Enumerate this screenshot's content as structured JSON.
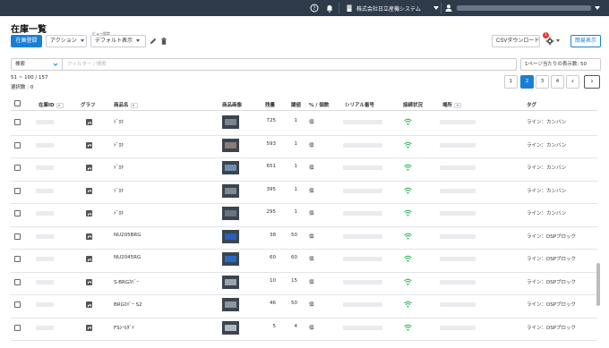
{
  "topbar": {
    "company": "株式会社日立産機システム",
    "icons": [
      "help-icon",
      "bell-icon",
      "building-icon",
      "user-icon"
    ]
  },
  "header": {
    "title": "在庫一覧",
    "register_label": "在庫登録",
    "action_label": "アクション",
    "view_setting_label": "ビュー設定",
    "view_value": "デフォルト表示",
    "csv_label": "CSVダウンロード",
    "settings_badge": "1",
    "simple_view_label": "簡易表示"
  },
  "search": {
    "field_label": "検索",
    "placeholder": "フィルター / 検索",
    "per_page_label": "1ページ当たりの表示数: 50"
  },
  "summary": {
    "range": "51 ~ 100 / 157",
    "selected": "選択数 : 0"
  },
  "pagination": {
    "pages": [
      "1",
      "2",
      "3",
      "4"
    ],
    "current": "2",
    "prev": "‹",
    "next": "›"
  },
  "table": {
    "columns": {
      "id": "在庫ID",
      "graph": "グラフ",
      "name": "商品名",
      "image": "商品画像",
      "qty": "残量",
      "threshold": "閾値",
      "unit": "% / 個数",
      "serial": "シリアル番号",
      "status": "接続状況",
      "place": "場所",
      "tag": "タグ"
    },
    "rows": [
      {
        "name": "ﾄﾞﾛｷ",
        "qty": "725",
        "threshold": "1",
        "unit": "個",
        "tag": "ライン：カンバン",
        "thumb": "#7a8590"
      },
      {
        "name": "ﾄﾞﾛｷ",
        "qty": "593",
        "threshold": "1",
        "unit": "個",
        "tag": "ライン：カンバン",
        "thumb": "#8a7f72"
      },
      {
        "name": "ﾄﾞﾛｷ",
        "qty": "651",
        "threshold": "1",
        "unit": "個",
        "tag": "ライン：カンバン",
        "thumb": "#6f8fb0"
      },
      {
        "name": "ﾄﾞﾛｷ",
        "qty": "395",
        "threshold": "1",
        "unit": "個",
        "tag": "ライン：カンバン",
        "thumb": "#808a94"
      },
      {
        "name": "ﾄﾞﾛｷ",
        "qty": "295",
        "threshold": "1",
        "unit": "個",
        "tag": "ライン：カンバン",
        "thumb": "#6a7480"
      },
      {
        "name": "NU205BRG",
        "qty": "38",
        "threshold": "50",
        "unit": "個",
        "tag": "ライン：DSPブロック",
        "thumb": "#2c5fb8"
      },
      {
        "name": "NU2045RG",
        "qty": "60",
        "threshold": "60",
        "unit": "個",
        "tag": "ライン：DSPブロック",
        "thumb": "#2a6ac0"
      },
      {
        "name": "S-BRGｶﾊﾞｰ",
        "qty": "10",
        "threshold": "15",
        "unit": "個",
        "tag": "ライン：DSPブロック",
        "thumb": "#9aa4ae"
      },
      {
        "name": "BRGｶﾊﾞｰ S2",
        "qty": "46",
        "threshold": "50",
        "unit": "個",
        "tag": "ライン：DSPブロック",
        "thumb": "#8c96a0"
      },
      {
        "name": "FSｼｰﾙﾀﾞｲ",
        "qty": "5",
        "threshold": "4",
        "unit": "個",
        "tag": "ライン：DSPブロック",
        "thumb": "#b0b8c0"
      }
    ]
  },
  "colors": {
    "topbar": "#2f3a4b",
    "primary": "#1a7fd4",
    "status_ok": "#22b24c",
    "badge": "#e53935"
  }
}
